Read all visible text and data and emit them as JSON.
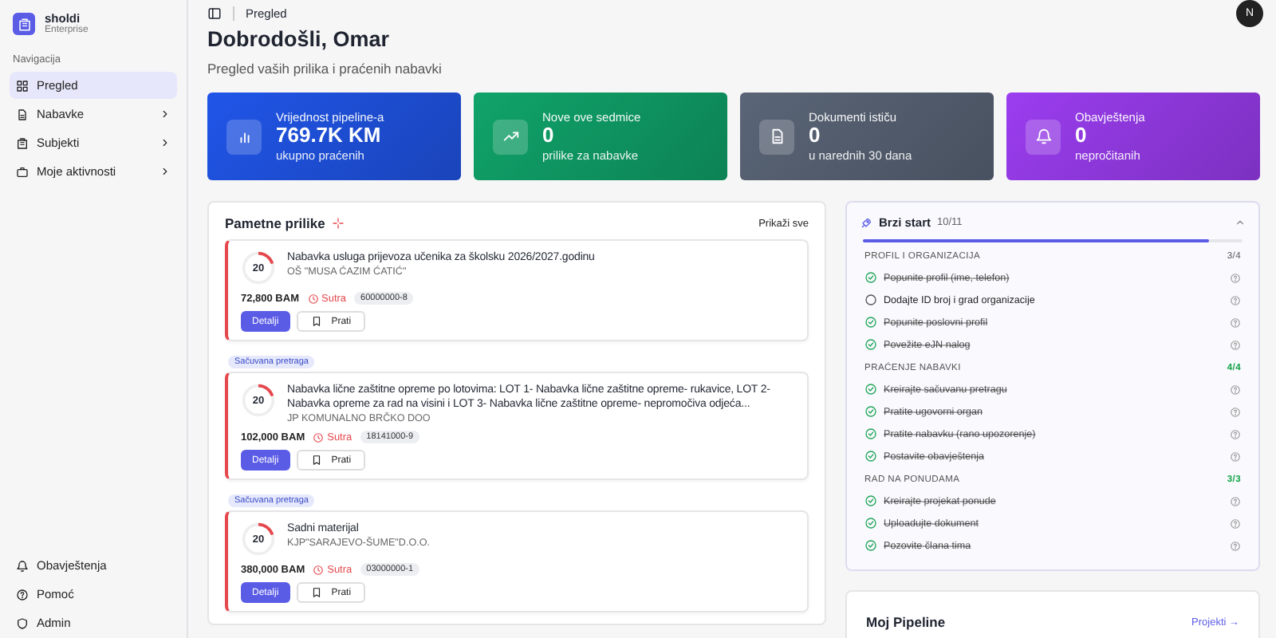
{
  "sidebar": {
    "brand": {
      "name": "sholdi",
      "plan": "Enterprise"
    },
    "section_label": "Navigacija",
    "items": [
      {
        "label": "Pregled",
        "selected": true,
        "expandable": false
      },
      {
        "label": "Nabavke",
        "selected": false,
        "expandable": true
      },
      {
        "label": "Subjekti",
        "selected": false,
        "expandable": true
      },
      {
        "label": "Moje aktivnosti",
        "selected": false,
        "expandable": true
      }
    ],
    "footer_items": [
      {
        "label": "Obavještenja"
      },
      {
        "label": "Pomoć"
      },
      {
        "label": "Admin"
      }
    ]
  },
  "header": {
    "breadcrumb": "Pregled",
    "avatar": "N"
  },
  "page": {
    "title": "Dobrodošli, Omar",
    "subtitle": "Pregled vaših prilika i praćenih nabavki"
  },
  "stats": [
    {
      "label": "Vrijednost pipeline-a",
      "value": "769.7K KM",
      "caption": "ukupno praćenih",
      "color": "#2055e8"
    },
    {
      "label": "Nove ove sedmice",
      "value": "0",
      "caption": "prilike za nabavke",
      "color": "#10a36a"
    },
    {
      "label": "Dokumenti ističu",
      "value": "0",
      "caption": "u narednih 30 dana",
      "color": "#5a6577"
    },
    {
      "label": "Obavještenja",
      "value": "0",
      "caption": "nepročitanih",
      "color": "#9b3df0"
    }
  ],
  "opportunities": {
    "title": "Pametne prilike",
    "show_all": "Prikaži sve",
    "items": [
      {
        "score": "20",
        "level": 0.2,
        "title": "Nabavka usluga prijevoza učenika za školsku 2026/2027.godinu",
        "org": "OŠ \"MUSA ĆAZIM ĆATIĆ\"",
        "amount": "72,800 BAM",
        "deadline": "Sutra",
        "code": "60000000-8",
        "details": "Detalji",
        "follow": "Prati"
      },
      {
        "tag": "Sačuvana pretraga",
        "score": "20",
        "level": 0.2,
        "title": "Nabavka lične zaštitne opreme po lotovima: LOT 1- Nabavka lične zaštitne opreme- rukavice, LOT 2- Nabavka opreme za rad na visini i LOT 3- Nabavka lične zaštitne opreme- nepromočiva odjeća...",
        "org": "JP KOMUNALNO BRČKO DOO",
        "amount": "102,000 BAM",
        "deadline": "Sutra",
        "code": "18141000-9",
        "details": "Detalji",
        "follow": "Prati"
      },
      {
        "tag": "Sačuvana pretraga",
        "score": "20",
        "level": 0.2,
        "title": "Sadni materijal",
        "org": "KJP\"SARAJEVO-ŠUME\"D.O.O.",
        "amount": "380,000 BAM",
        "deadline": "Sutra",
        "code": "03000000-1",
        "details": "Detalji",
        "follow": "Prati"
      }
    ]
  },
  "quick_start": {
    "title": "Brzi start",
    "count": "10/11",
    "level": 0.91,
    "expanded": true,
    "sections": [
      {
        "title": "PROFIL I ORGANIZACIJA",
        "count": "3/4",
        "complete": false,
        "items": [
          {
            "label": "Popunite profil (ime, telefon)",
            "done": true
          },
          {
            "label": "Dodajte ID broj i grad organizacije",
            "done": false
          },
          {
            "label": "Popunite poslovni profil",
            "done": true
          },
          {
            "label": "Povežite eJN nalog",
            "done": true
          }
        ]
      },
      {
        "title": "PRAĆENJE NABAVKI",
        "count": "4/4",
        "complete": true,
        "items": [
          {
            "label": "Kreirajte sačuvanu pretragu",
            "done": true
          },
          {
            "label": "Pratite ugovorni organ",
            "done": true
          },
          {
            "label": "Pratite nabavku (rano upozorenje)",
            "done": true
          },
          {
            "label": "Postavite obavještenja",
            "done": true
          }
        ]
      },
      {
        "title": "RAD NA PONUDAMA",
        "count": "3/3",
        "complete": true,
        "items": [
          {
            "label": "Kreirajte projekat ponude",
            "done": true
          },
          {
            "label": "Uploadujte dokument",
            "done": true
          },
          {
            "label": "Pozovite člana tima",
            "done": true
          }
        ]
      }
    ]
  },
  "pipeline": {
    "title": "Moj Pipeline",
    "link": "Projekti →"
  }
}
